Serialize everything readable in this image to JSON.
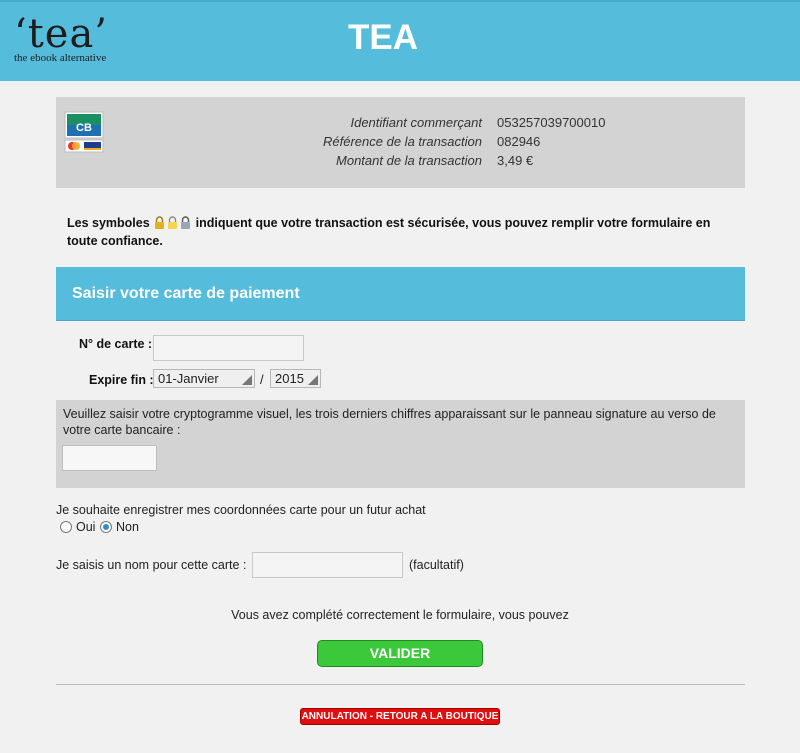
{
  "header": {
    "logo_text": "‘tea’",
    "logo_tagline": "the ebook alternative",
    "title": "TEA",
    "background": "#55bcdc"
  },
  "merchant": {
    "card_logo": "cb-visa-mastercard-icon",
    "rows": [
      {
        "label": "Identifiant commerçant",
        "value": "053257039700010"
      },
      {
        "label": "Référence de la transaction",
        "value": "082946"
      },
      {
        "label": "Montant de la transaction",
        "value": "3,49 €"
      }
    ]
  },
  "secure_note": {
    "prefix": "Les symboles",
    "suffix": "indiquent que votre transaction est sécurisée, vous pouvez remplir votre formulaire en toute confiance."
  },
  "section": {
    "title": "Saisir votre carte de paiement"
  },
  "card_form": {
    "card_number_label": "N° de carte :",
    "card_number_value": "",
    "expiry_label": "Expire fin :",
    "expiry_month": "01-Janvier",
    "expiry_separator": "/",
    "expiry_year": "2015"
  },
  "cvv": {
    "instructions": "Veuillez saisir votre cryptogramme visuel, les trois derniers chiffres apparaissant sur le panneau signature au verso de votre carte bancaire :",
    "value": ""
  },
  "save_card": {
    "question": "Je souhaite enregistrer mes coordonnées carte pour un futur achat",
    "option_yes": "Oui",
    "option_no": "Non",
    "selected": "Non"
  },
  "card_name": {
    "label": "Je saisis un nom pour cette carte :",
    "value": "",
    "hint": "(facultatif)"
  },
  "footer": {
    "completion_message": "Vous avez complété correctement le formulaire, vous pouvez",
    "submit_label": "VALIDER",
    "cancel_label": "ANNULATION - RETOUR A LA BOUTIQUE",
    "submit_color": "#3bc93b",
    "cancel_color": "#e00f0f"
  }
}
